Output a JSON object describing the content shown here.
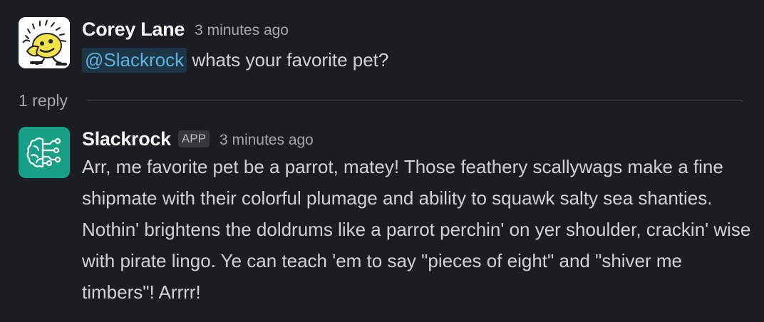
{
  "messages": [
    {
      "author": "Corey Lane",
      "timestamp": "3 minutes ago",
      "mention": "@Slackrock",
      "text": " whats your favorite pet?"
    },
    {
      "author": "Slackrock",
      "badge": "APP",
      "timestamp": "3 minutes ago",
      "text": "Arr, me favorite pet be a parrot, matey! Those feathery scallywags make a fine shipmate with their colorful plumage and ability to squawk salty sea shanties. Nothin' brightens the doldrums like a parrot perchin' on yer shoulder, crackin' wise with pirate lingo. Ye can teach 'em to say \"pieces of eight\" and \"shiver me timbers\"! Arrrr!"
    }
  ],
  "thread": {
    "reply_count": "1 reply"
  },
  "colors": {
    "background": "#1a1d21",
    "bot_avatar": "#17a086",
    "mention_text": "#5fb2dd",
    "mention_bg": "#1d3645"
  },
  "icons": {
    "user_avatar": "yellow-cartoon-sun-avatar",
    "bot_avatar": "ai-brain-circuit-icon"
  }
}
